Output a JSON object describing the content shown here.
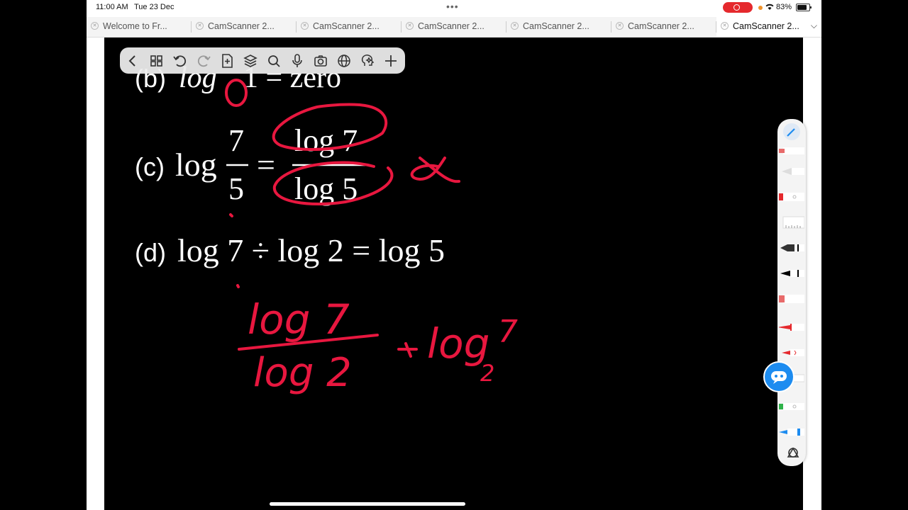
{
  "status": {
    "time": "11:00 AM",
    "date": "Tue 23 Dec",
    "battery": "83%",
    "colors": {
      "record": "#e5292d",
      "dot": "#f0932b"
    }
  },
  "tabs": [
    {
      "label": "Welcome to Fr...",
      "active": false
    },
    {
      "label": "CamScanner 2...",
      "active": false
    },
    {
      "label": "CamScanner 2...",
      "active": false
    },
    {
      "label": "CamScanner 2...",
      "active": false
    },
    {
      "label": "CamScanner 2...",
      "active": false
    },
    {
      "label": "CamScanner 2...",
      "active": false
    },
    {
      "label": "CamScanner 2...",
      "active": true
    }
  ],
  "document": {
    "line_b": {
      "tag": "(b)",
      "pre": "log",
      "post": "1 = zero"
    },
    "line_c": {
      "tag": "(c)",
      "log": "log",
      "num": "7",
      "den": "5",
      "eq": "=",
      "rnum": "log 7",
      "rden": "log 5"
    },
    "line_d": {
      "tag": "(d)",
      "expr": "log 7 ÷ log 2 = log 5"
    }
  },
  "annotations": {
    "ink_color": "#e8173f",
    "handwriting": {
      "a": "log 7",
      "b": "log 2",
      "c": "log",
      "c_sup": "7",
      "c_sub": "2"
    }
  },
  "toolbar_icons": [
    "back-icon",
    "grid-icon",
    "undo-icon",
    "redo-icon",
    "add-page-icon",
    "layers-icon",
    "search-icon",
    "microphone-icon",
    "camera-icon",
    "globe-icon",
    "ai-brain-icon",
    "plus-icon"
  ],
  "pen_tray_icons": [
    "pen-active-icon",
    "marker-icon",
    "pencil-icon",
    "eraser-icon",
    "ruler-icon",
    "fountain-pen-icon",
    "black-pen-icon",
    "red-marker-icon",
    "red-pen-icon",
    "red-brush-icon",
    "white-pen-icon",
    "green-pen-icon",
    "blue-pen-icon",
    "shapes-icon"
  ],
  "assistant_icon": "chat-bot-icon"
}
